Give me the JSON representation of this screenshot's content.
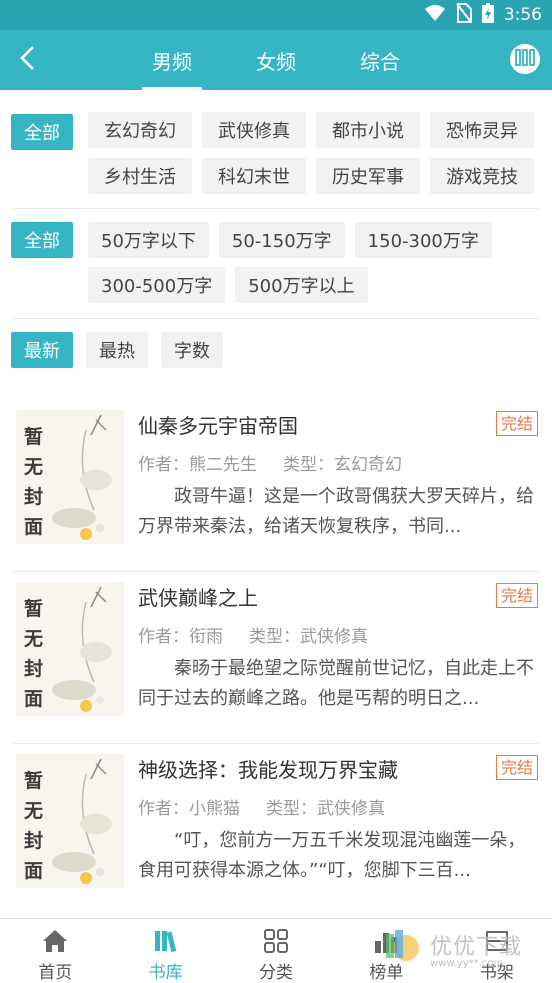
{
  "status_bar": {
    "time": "3:56"
  },
  "app_bar": {
    "tabs": [
      {
        "label": "男频",
        "active": true
      },
      {
        "label": "女频",
        "active": false
      },
      {
        "label": "综合",
        "active": false
      }
    ]
  },
  "filters": {
    "genre": {
      "selected": "全部",
      "options": [
        "玄幻奇幻",
        "武侠修真",
        "都市小说",
        "恐怖灵异",
        "乡村生活",
        "科幻末世",
        "历史军事",
        "游戏竞技"
      ]
    },
    "length": {
      "selected": "全部",
      "options": [
        "50万字以下",
        "50-150万字",
        "150-300万字",
        "300-500万字",
        "500万字以上"
      ]
    },
    "sort": {
      "options": [
        "最新",
        "最热",
        "字数"
      ],
      "selected_index": 0
    }
  },
  "books": [
    {
      "cover_text": "暂无封面",
      "title": "仙秦多元宇宙帝国",
      "status": "完结",
      "author_label": "作者：",
      "author": "熊二先生",
      "type_label": "类型：",
      "type": "玄幻奇幻",
      "description": "政哥牛逼！这是一个政哥偶获大罗天碎片，给万界带来秦法，给诸天恢复秩序，书同..."
    },
    {
      "cover_text": "暂无封面",
      "title": "武侠巅峰之上",
      "status": "完结",
      "author_label": "作者：",
      "author": "衔雨",
      "type_label": "类型：",
      "type": "武侠修真",
      "description": "秦旸于最绝望之际觉醒前世记忆，自此走上不同于过去的巅峰之路。他是丐帮的明日之..."
    },
    {
      "cover_text": "暂无封面",
      "title": "神级选择：我能发现万界宝藏",
      "status": "完结",
      "author_label": "作者：",
      "author": "小熊猫",
      "type_label": "类型：",
      "type": "武侠修真",
      "description": "“叮，您前方一万五千米发现混沌幽莲一朵，食用可获得本源之体。”“叮，您脚下三百..."
    }
  ],
  "bottom_nav": [
    {
      "label": "首页",
      "icon": "home-icon",
      "active": false
    },
    {
      "label": "书库",
      "icon": "library-icon",
      "active": true
    },
    {
      "label": "分类",
      "icon": "category-icon",
      "active": false
    },
    {
      "label": "榜单",
      "icon": "ranking-icon",
      "active": false
    },
    {
      "label": "书架",
      "icon": "bookshelf-icon",
      "active": false
    }
  ],
  "watermark": {
    "text": "优优下载",
    "url": "www.yy**.com"
  },
  "colors": {
    "accent": "#36b6c4",
    "status_bar": "#2aa3b2",
    "badge": "#e87a4a"
  }
}
